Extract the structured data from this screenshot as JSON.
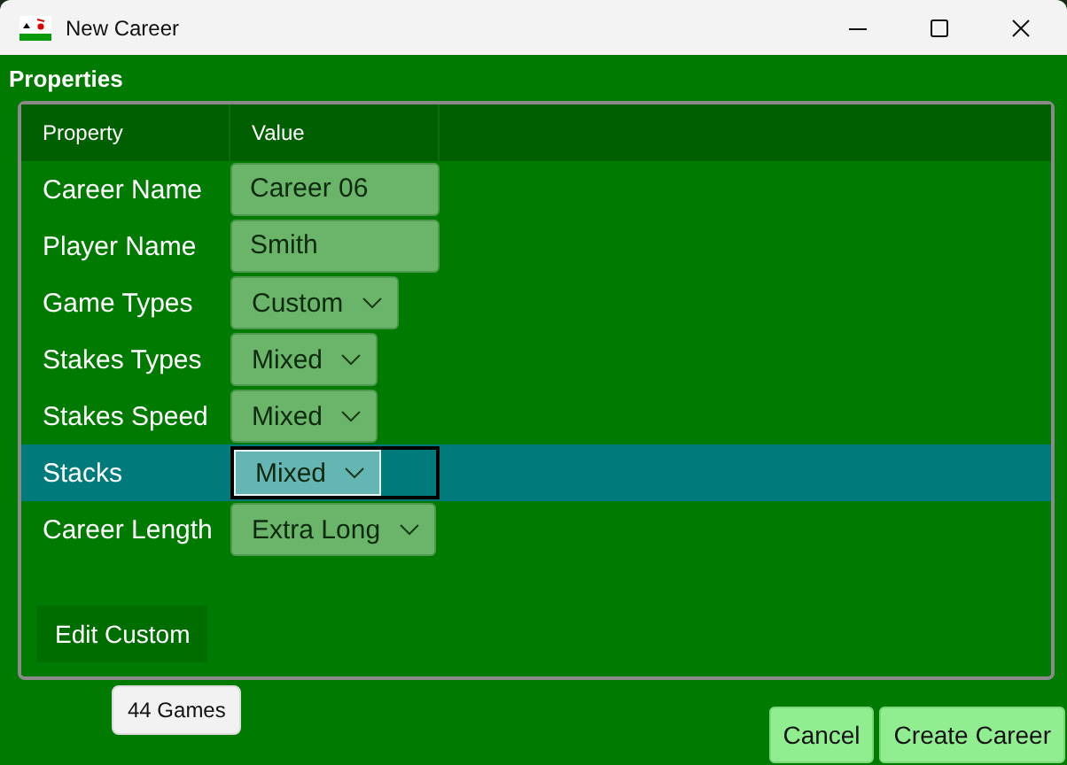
{
  "window": {
    "title": "New Career"
  },
  "section_title": "Properties",
  "table": {
    "columns": [
      "Property",
      "Value"
    ],
    "rows": [
      {
        "label": "Career Name",
        "kind": "text",
        "value": "Career 06",
        "selected": false
      },
      {
        "label": "Player Name",
        "kind": "text",
        "value": "Smith",
        "selected": false
      },
      {
        "label": "Game Types",
        "kind": "combo",
        "value": "Custom",
        "selected": false
      },
      {
        "label": "Stakes Types",
        "kind": "combo",
        "value": "Mixed",
        "selected": false
      },
      {
        "label": "Stakes Speed",
        "kind": "combo",
        "value": "Mixed",
        "selected": false
      },
      {
        "label": "Stacks",
        "kind": "combo",
        "value": "Mixed",
        "selected": true
      },
      {
        "label": "Career Length",
        "kind": "combo",
        "value": "Extra Long",
        "selected": false
      }
    ]
  },
  "edit_button": "Edit Custom",
  "tooltip": "44 Games",
  "buttons": [
    "Cancel",
    "Create Career"
  ]
}
